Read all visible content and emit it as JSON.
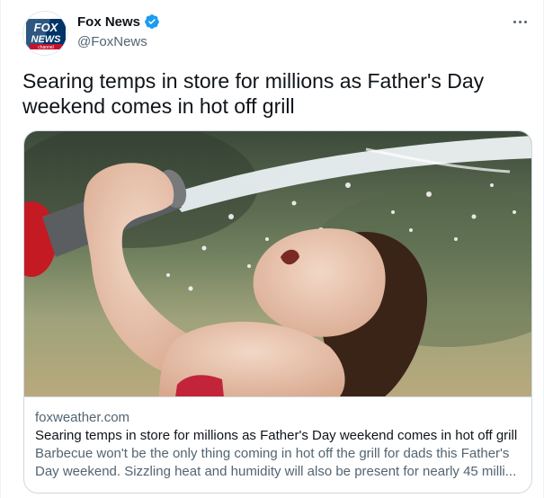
{
  "author": {
    "display_name": "Fox News",
    "handle": "@FoxNews",
    "verified": true,
    "avatar_logo": {
      "line1": "FOX",
      "line2": "NEWS",
      "line3": "channel"
    }
  },
  "tweet": {
    "text": "Searing temps in store for millions as Father's Day weekend comes in hot off grill"
  },
  "card": {
    "domain": "foxweather.com",
    "title": "Searing temps in store for millions as Father's Day weekend comes in hot off grill",
    "description": "Barbecue won't be the only thing coming in hot off the grill for dads this Father's Day weekend. Sizzling heat and humidity will also be present for nearly 45 milli..."
  },
  "icons": {
    "more": "more-horizontal-icon",
    "verified": "verified-badge-icon"
  },
  "colors": {
    "text_primary": "#0f1419",
    "text_secondary": "#536471",
    "verified_blue": "#1d9bf0",
    "border": "#cfd9de",
    "fox_red": "#c8102e",
    "fox_blue": "#003366"
  }
}
